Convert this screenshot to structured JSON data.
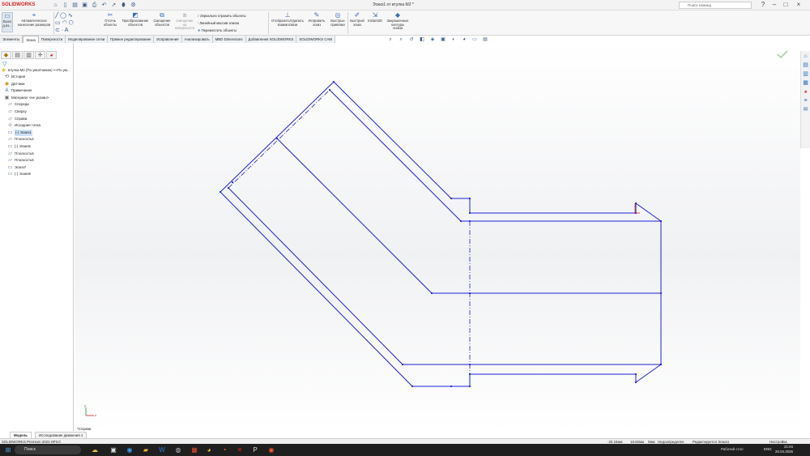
{
  "app": {
    "logo": "SOLIDWORKS",
    "doc_title": "Эскиз1 от втулка М2 *",
    "search_placeholder": "Поиск команд"
  },
  "qat_icons": [
    "home-icon",
    "new-icon",
    "open-icon",
    "save-icon",
    "print-icon",
    "undo-icon",
    "select-icon",
    "rebuild-icon",
    "options-icon"
  ],
  "ribbon": {
    "exit_sketch": "Выхо\nд из...",
    "smart_dim": "Автоматическое\nнанесение размеров",
    "trim": "Отсечь\nобъекты",
    "convert": "Преобразование\nобъектов",
    "offset": "Смещение\nобъектов",
    "offset_surface": "Смещение\nна\nповерхности",
    "mirror": "Зеркально отразить объекты",
    "linear_pattern": "Линейный массив эскиза",
    "move": "Переместить объекты",
    "relations": "Отобразить/Удалить\nвзаимосвязи",
    "repair": "Исправить\nэскиз",
    "quick_snaps": "Быстрые\nпривязки",
    "rapid_sketch": "Быстрый\nэскиз",
    "instant2d": "Instant2D",
    "shaded_contours": "Закрашенные\nконтуры\nэскиза"
  },
  "tabs": [
    "Элементы",
    "Эскиз",
    "Поверхности",
    "Моделирование сетки",
    "Прямое редактирование",
    "Исправления",
    "Анализировать",
    "MBD Dimensions",
    "Добавления SOLIDWORKS",
    "SOLIDWORKS CAM"
  ],
  "active_tab": "Эскиз",
  "tree": {
    "root": "втулка М2 (По умолчанию) <<По ум...",
    "items": [
      {
        "label": "История",
        "icon": "history-icon"
      },
      {
        "label": "Датчики",
        "icon": "sensors-icon"
      },
      {
        "label": "Примечания",
        "icon": "annotations-icon"
      },
      {
        "label": "Материал <не указан>",
        "icon": "material-icon"
      },
      {
        "label": "Спереди",
        "icon": "plane-icon"
      },
      {
        "label": "Сверху",
        "icon": "plane-icon"
      },
      {
        "label": "Справа",
        "icon": "plane-icon"
      },
      {
        "label": "Исходная точка",
        "icon": "origin-icon"
      },
      {
        "label": "(-) Эскиз1",
        "icon": "sketch-icon"
      },
      {
        "label": "Плоскость4",
        "icon": "plane-icon"
      },
      {
        "label": "(-) Эскиз5",
        "icon": "sketch-icon"
      },
      {
        "label": "Плоскость5",
        "icon": "plane-icon"
      },
      {
        "label": "Плоскость6",
        "icon": "plane-icon"
      },
      {
        "label": "Эскиз7",
        "icon": "sketch-icon"
      },
      {
        "label": "(-) Эскиз9",
        "icon": "sketch-icon"
      }
    ]
  },
  "viewport": {
    "view_label": "*Справа"
  },
  "model_tabs": [
    "Модель",
    "Исследование движения 1"
  ],
  "status": {
    "product": "SOLIDWORKS Premium 2023 SP3.0",
    "x": "-20.15мм",
    "y": "18.82мм",
    "z": "0мм",
    "state": "Недоопределен",
    "editing": "Редактируется Эскиз1",
    "custom": "Настройка"
  },
  "taskbar": {
    "search": "Поиск",
    "desktop": "Рабочий стол",
    "lang": "ENG",
    "time": "21:04",
    "date": "20.04.2026"
  },
  "colors": {
    "sketch": "#1d22d6",
    "accent": "#d22"
  }
}
